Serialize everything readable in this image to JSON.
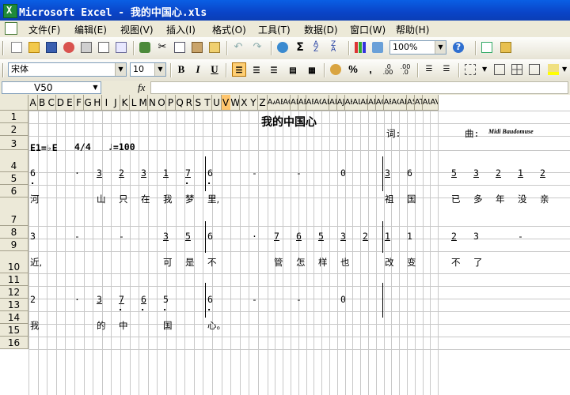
{
  "titlebar": {
    "app_icon": "excel-app-icon",
    "title": "Microsoft Excel - 我的中国心.xls"
  },
  "menubar": {
    "items": [
      "文件(F)",
      "编辑(E)",
      "视图(V)",
      "插入(I)",
      "格式(O)",
      "工具(T)",
      "数据(D)",
      "窗口(W)",
      "帮助(H)"
    ]
  },
  "toolbar": {
    "zoom": "100%",
    "font_name": "宋体",
    "font_size": "10",
    "bold": "B",
    "italic": "I",
    "underline": "U",
    "percent": "%",
    "comma": ","
  },
  "formula_bar": {
    "name_box": "V50",
    "fx": "fx",
    "value": ""
  },
  "columns": [
    "A",
    "B",
    "C",
    "D",
    "E",
    "F",
    "G",
    "H",
    "I",
    "J",
    "K",
    "L",
    "M",
    "N",
    "O",
    "P",
    "Q",
    "R",
    "S",
    "T",
    "U",
    "V",
    "W",
    "X",
    "Y",
    "Z",
    "AA",
    "AB",
    "AC",
    "AD",
    "AE",
    "AF",
    "AG",
    "AH",
    "AI",
    "AJ",
    "AK",
    "AL",
    "AM",
    "AN",
    "AO",
    "AP",
    "AQ",
    "AR",
    "AS",
    "AT",
    "AU",
    "AV"
  ],
  "selected_column": "V",
  "rows": [
    "1",
    "2",
    "3",
    "4",
    "5",
    "6",
    "7",
    "8",
    "9",
    "10",
    "11",
    "12",
    "13",
    "14",
    "15",
    "16"
  ],
  "sheet": {
    "title": "我的中国心",
    "lyricist_label": "词:",
    "composer_label": "曲:",
    "watermark": "Midi Baudomuse",
    "key": "E1=♭E",
    "time": "4/4",
    "tempo": "♩=100",
    "notes_row4": [
      "6",
      "·",
      "3",
      "2",
      "3",
      "1",
      "7",
      "6",
      "-",
      "-",
      "0",
      "3",
      "6",
      "5",
      "3",
      "2",
      "1",
      "2"
    ],
    "lyrics_row5": [
      "河",
      "山",
      "只",
      "在",
      "我",
      "梦",
      "里,",
      "祖",
      "国",
      "已",
      "多",
      "年",
      "没",
      "亲"
    ],
    "notes_row7": [
      "3",
      "-",
      "-",
      "3",
      "5",
      "6",
      "·",
      "7",
      "6",
      "5",
      "3",
      "2",
      "1",
      "1",
      "2",
      "3",
      "-"
    ],
    "lyrics_row8": [
      "近,",
      "可",
      "是",
      "不",
      "管",
      "怎",
      "样",
      "也",
      "改",
      "变",
      "不",
      "了"
    ],
    "notes_row10": [
      "2",
      "·",
      "3",
      "7",
      "6",
      "5",
      "6",
      "-",
      "-",
      "0"
    ],
    "lyrics_row11": [
      "我",
      "的",
      "中",
      "国",
      "心。"
    ]
  }
}
